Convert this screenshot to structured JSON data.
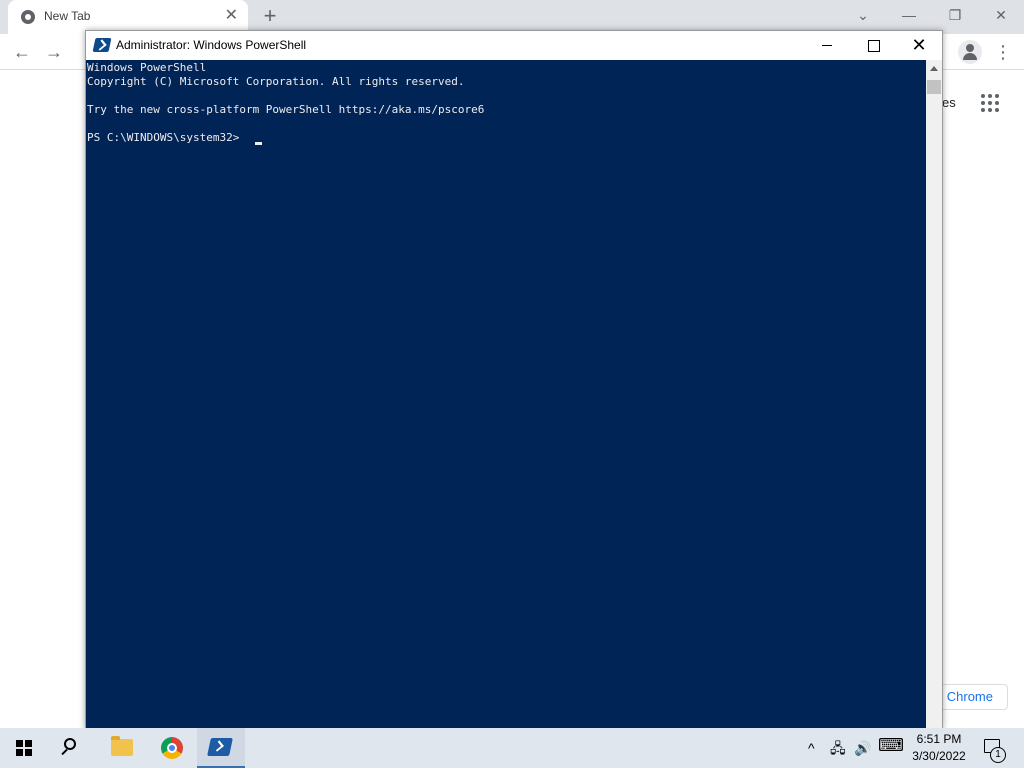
{
  "chrome": {
    "tab_title": "New Tab",
    "tab_close": "✕",
    "new_tab": "+",
    "back": "←",
    "forward": "→",
    "menu": "⋮",
    "partial_text": "es",
    "bottom_button": "Chrome",
    "controls": {
      "dropdown": "⌄",
      "minimize": "—",
      "restore": "❐",
      "close": "✕"
    }
  },
  "powershell": {
    "title": "Administrator: Windows PowerShell",
    "close_glyph": "✕",
    "console_lines": [
      "Windows PowerShell",
      "Copyright (C) Microsoft Corporation. All rights reserved.",
      "",
      "Try the new cross-platform PowerShell https://aka.ms/pscore6",
      "",
      "PS C:\\WINDOWS\\system32> "
    ],
    "console_bg": "#012456",
    "console_fg": "#eeedf0"
  },
  "taskbar": {
    "tray": {
      "chevron": "^",
      "network": "🖧",
      "volume": "🔊",
      "keyboard": "⌨"
    },
    "time": "6:51 PM",
    "date": "3/30/2022",
    "notification_count": "1"
  }
}
